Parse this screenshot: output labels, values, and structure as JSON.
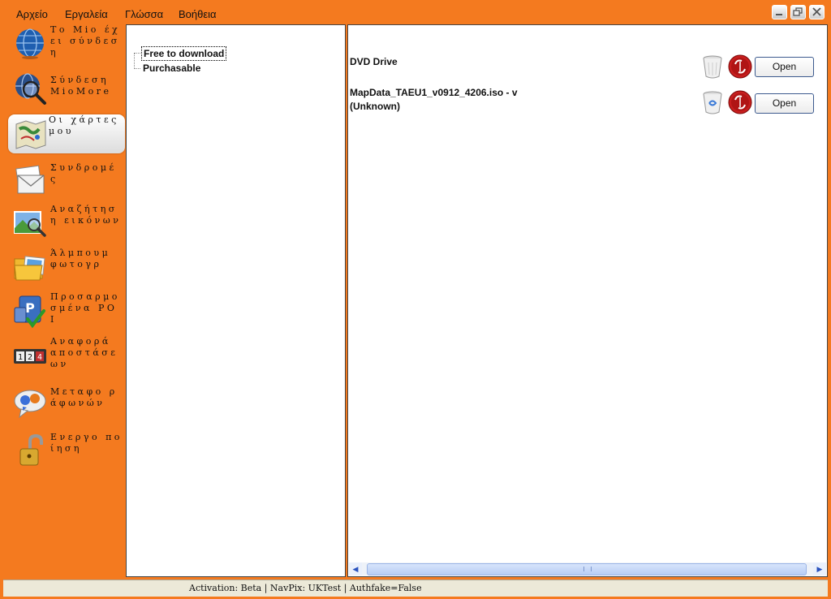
{
  "menu": {
    "file": "Αρχείο",
    "tools": "Εργαλεία",
    "language": "Γλώσσα",
    "help": "Βοήθεια"
  },
  "window_buttons": {
    "minimize": "minimize-icon",
    "restore": "restore-icon",
    "close": "close-icon"
  },
  "sidebar": {
    "items": [
      {
        "label": "Το Mio έχει σύνδεση",
        "icon": "globe-icon"
      },
      {
        "label": "Σύνδεση MioMore",
        "icon": "globe-search-icon"
      },
      {
        "label": "Οι χάρτες μου",
        "icon": "map-icon",
        "selected": true
      },
      {
        "label": "Συνδρομές",
        "icon": "envelope-icon"
      },
      {
        "label": "Αναζήτηση εικόνων",
        "icon": "image-search-icon"
      },
      {
        "label": "Άλμπουμ φωτογρ",
        "icon": "photo-album-icon"
      },
      {
        "label": "Προσαρμοσμένα POI",
        "icon": "poi-icon"
      },
      {
        "label": "Αναφορά αποστάσεων",
        "icon": "odometer-icon"
      },
      {
        "label": "Μεταφο ράφωνών",
        "icon": "speech-bubbles-icon"
      },
      {
        "label": "Ενεργο ποίηση",
        "icon": "padlock-icon"
      }
    ]
  },
  "tree": {
    "items": [
      "Free to download",
      "Purchasable"
    ]
  },
  "drives": [
    {
      "name": "DVD Drive",
      "open_label": "Open"
    },
    {
      "name": "MapData_TAEU1_v0912_4206.iso - v (Unknown)",
      "open_label": "Open"
    }
  ],
  "scrollbar": {
    "left_arrow": "◀",
    "right_arrow": "▶"
  },
  "status": {
    "text": "Activation: Beta  |  NavPix: UKTest  |  Authfake=False"
  },
  "colors": {
    "accent": "#f47a1f",
    "button_border": "#3c5a8e"
  }
}
